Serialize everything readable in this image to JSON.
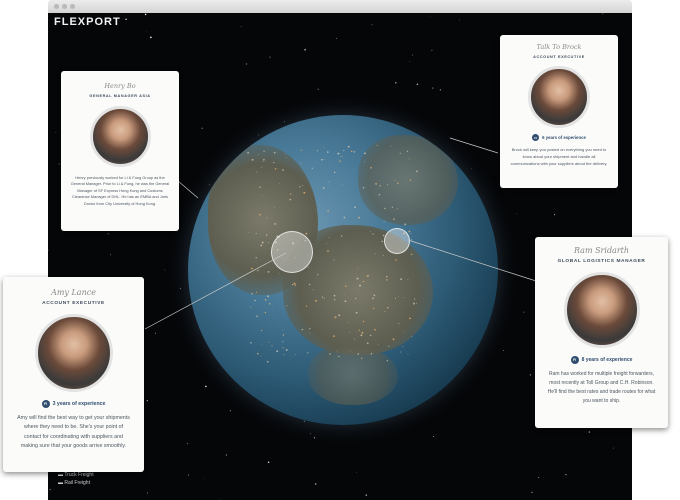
{
  "app": {
    "logo": "FLEXPORT"
  },
  "legend": {
    "items": [
      "Truck Freight",
      "Rail Freight"
    ]
  },
  "cards": {
    "henry": {
      "name": "Henry Bo",
      "role": "GENERAL MANAGER ASIA",
      "bio": "Henry previously worked for Li & Fung Group as the General Manager. Prior to Li & Fung, he was the General Manager of SF Express Hong Kong and Customs Clearance Manager of DHL. He has an EMBA and Juris Doctor from City University of Hong Kong."
    },
    "brock": {
      "name": "Talk To Brock",
      "role": "ACCOUNT EXECUTIVE",
      "experience": "6 years of experience",
      "badge": "FI",
      "bio": "Brock will keep you posted on everything you need to know about your shipment and handle all communications with your suppliers about the delivery."
    },
    "ram": {
      "name": "Ram Sridarth",
      "role": "GLOBAL LOGISTICS MANAGER",
      "experience": "8 years of experience",
      "badge": "FI",
      "bio": "Ram has worked for multiple freight forwarders, most recently at Toll Group and C.H. Robinson. He'll find the best rates and trade routes for what you want to ship."
    },
    "amy": {
      "name": "Amy Lance",
      "role": "ACCOUNT EXECUTIVE",
      "experience": "3 years of experience",
      "badge": "FI",
      "bio": "Amy will find the best way to get your shipments where they need to be. She's your point of contact for coordinating with suppliers and making sure that your goods arrive smoothly."
    }
  }
}
